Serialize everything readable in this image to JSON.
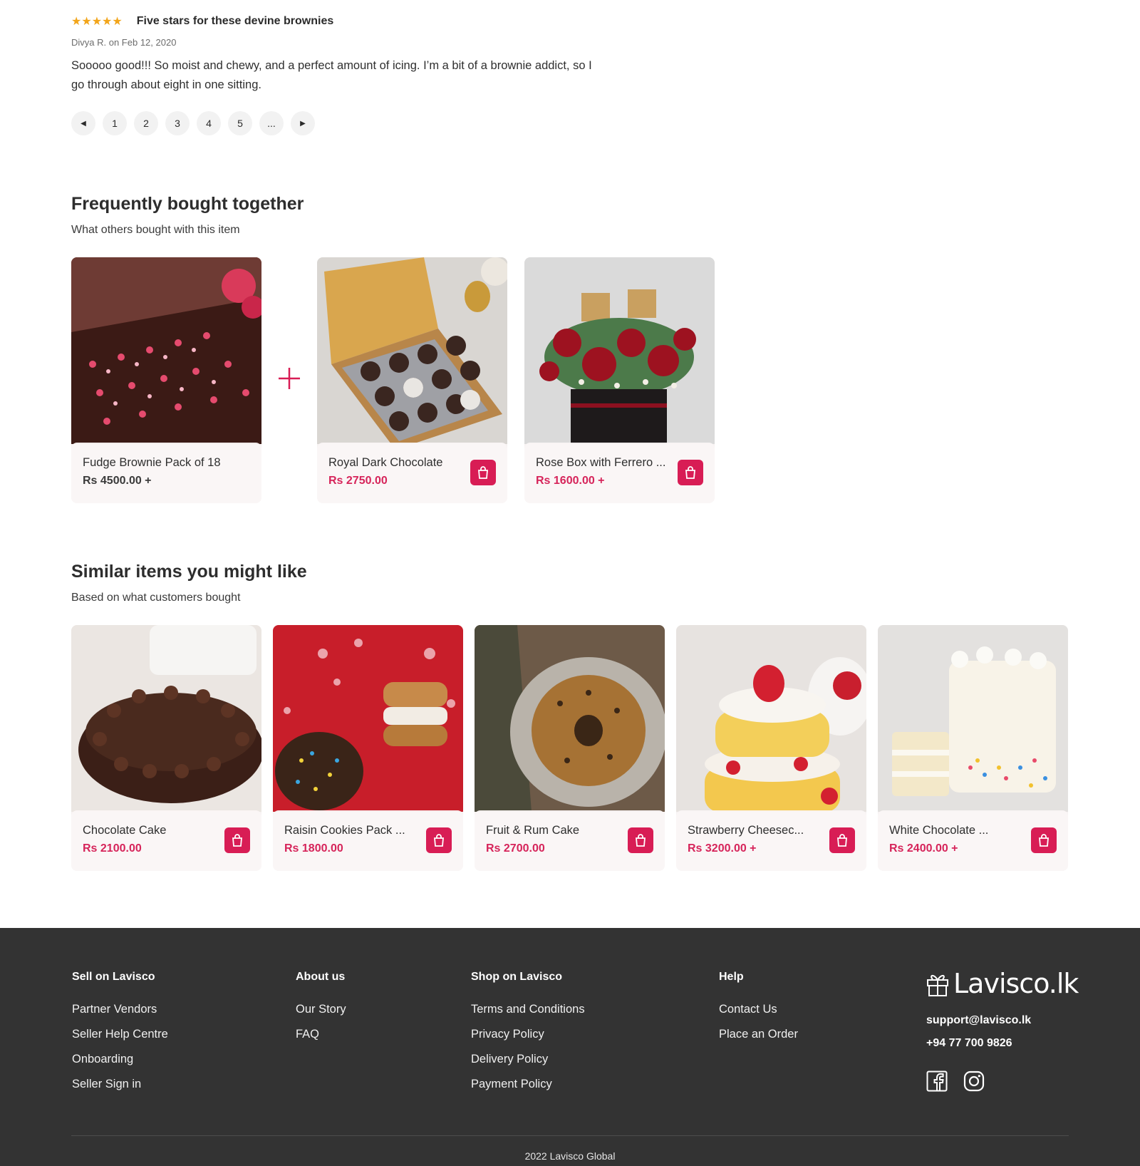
{
  "review": {
    "stars": "★★★★★",
    "rating": 5,
    "title": "Five stars for these devine brownies",
    "meta": "Divya R. on Feb 12, 2020",
    "body": "Sooooo good!!! So moist and chewy, and a perfect amount of icing. I’m a bit of a brownie addict, so I go through about eight in one sitting."
  },
  "pagination": {
    "prev": "◀",
    "pages": [
      "1",
      "2",
      "3",
      "4",
      "5",
      "..."
    ],
    "next": "▶"
  },
  "frequently_bought": {
    "title": "Frequently bought together",
    "subtitle": "What others bought with this item",
    "items": [
      {
        "name": "Fudge Brownie Pack of 18",
        "price": "Rs 4500.00 +"
      },
      {
        "name": "Royal Dark Chocolate",
        "price": "Rs 2750.00"
      },
      {
        "name": "Rose Box with Ferrero ...",
        "price": "Rs 1600.00 +"
      }
    ]
  },
  "similar_items": {
    "title": "Similar items you might like",
    "subtitle": "Based on what customers bought",
    "items": [
      {
        "name": "Chocolate Cake",
        "price": "Rs 2100.00"
      },
      {
        "name": "Raisin Cookies Pack ...",
        "price": "Rs 1800.00"
      },
      {
        "name": "Fruit & Rum Cake",
        "price": "Rs 2700.00"
      },
      {
        "name": "Strawberry Cheesec...",
        "price": "Rs 3200.00 +"
      },
      {
        "name": "White Chocolate ...",
        "price": "Rs 2400.00 +"
      }
    ]
  },
  "footer": {
    "sell": {
      "heading": "Sell on Lavisco",
      "links": [
        "Partner Vendors",
        "Seller Help Centre",
        "Onboarding",
        "Seller Sign in"
      ]
    },
    "about": {
      "heading": "About us",
      "links": [
        "Our Story",
        "FAQ"
      ]
    },
    "shop": {
      "heading": "Shop on Lavisco",
      "links": [
        "Terms and Conditions",
        "Privacy Policy",
        "Delivery Policy",
        "Payment Policy"
      ]
    },
    "help": {
      "heading": "Help",
      "links": [
        "Contact Us",
        "Place an Order"
      ]
    },
    "brand": {
      "logo_text": "Lavisco.lk",
      "email": "support@lavisco.lk",
      "phone": "+94 77 700 9826",
      "social_icons": [
        "facebook-icon",
        "instagram-icon"
      ]
    },
    "copyright": "2022 Lavisco Global"
  },
  "colors": {
    "accent": "#d81d55",
    "price": "#d6245a",
    "star": "#f2a51a",
    "footer_bg": "#333333"
  }
}
